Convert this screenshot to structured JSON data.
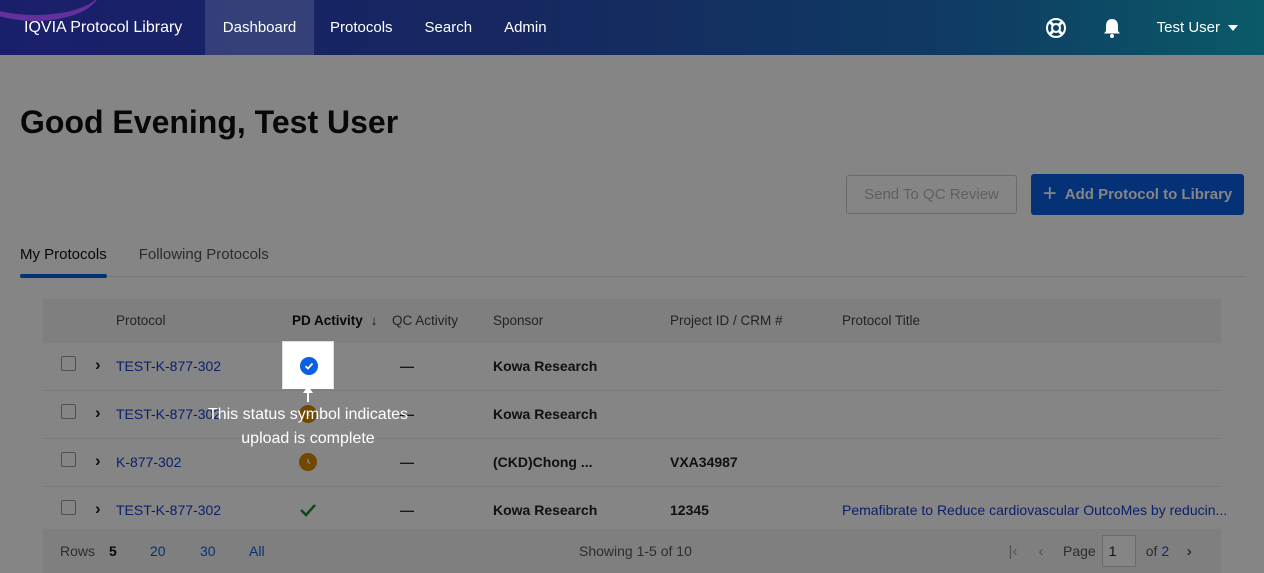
{
  "nav": {
    "brand": "IQVIA Protocol Library",
    "items": [
      "Dashboard",
      "Protocols",
      "Search",
      "Admin"
    ],
    "user": "Test User"
  },
  "greeting": "Good Evening, Test User",
  "actions": {
    "send_qc": "Send To QC Review",
    "add_protocol": "Add Protocol to Library"
  },
  "tabs": [
    "My Protocols",
    "Following Protocols"
  ],
  "table": {
    "headers": [
      "Protocol",
      "PD Activity",
      "QC Activity",
      "Sponsor",
      "Project ID / CRM #",
      "Protocol Title"
    ],
    "rows": [
      {
        "protocol": "TEST-K-877-302",
        "pd_status": "complete",
        "qc": "—",
        "sponsor": "Kowa Research",
        "project": "",
        "title": ""
      },
      {
        "protocol": "TEST-K-877-302",
        "pd_status": "in-progress",
        "qc": "—",
        "sponsor": "Kowa Research",
        "project": "",
        "title": ""
      },
      {
        "protocol": "K-877-302",
        "pd_status": "in-progress",
        "qc": "—",
        "sponsor": "(CKD)Chong ...",
        "project": "VXA34987",
        "title": ""
      },
      {
        "protocol": "TEST-K-877-302",
        "pd_status": "done",
        "qc": "—",
        "sponsor": "Kowa Research",
        "project": "12345",
        "title": "Pemafibrate to Reduce cardiovascular OutcoMes by reducin..."
      }
    ]
  },
  "footer": {
    "rows_label": "Rows",
    "rows_options": [
      "5",
      "20",
      "30",
      "All"
    ],
    "showing": "Showing 1-5 of 10",
    "page_label": "Page",
    "page_value": "1",
    "of_label": "of",
    "total_pages": "2"
  },
  "coach_mark": {
    "line1": "This status symbol indicates",
    "line2": "upload is complete"
  },
  "colors": {
    "accent": "#0a5fe3",
    "link": "#1a3cc8",
    "in_progress": "#d98a00",
    "done": "#1f8a3a"
  }
}
